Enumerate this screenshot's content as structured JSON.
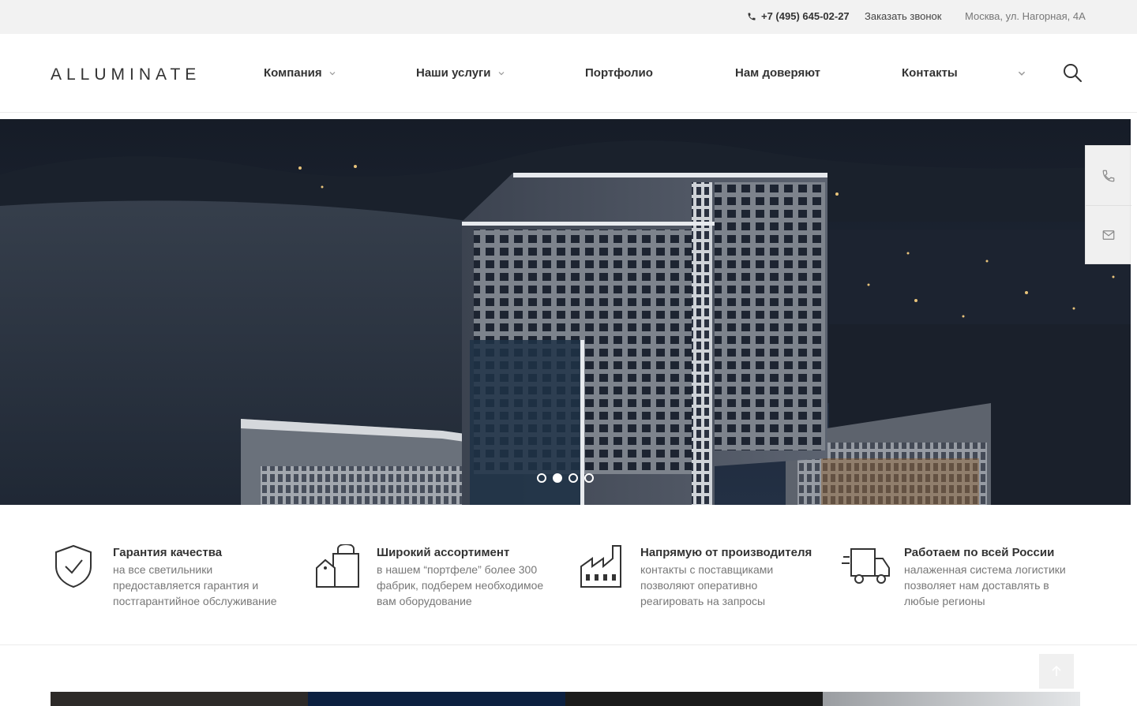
{
  "topbar": {
    "phone": "+7 (495) 645-02-27",
    "callback": "Заказать звонок",
    "address": "Москва, ул. Нагорная, 4А"
  },
  "header": {
    "logo": "ALLUMINATE",
    "nav": [
      {
        "label": "Компания"
      },
      {
        "label": "Наши услуги"
      },
      {
        "label": "Портфолио"
      },
      {
        "label": "Нам доверяют"
      },
      {
        "label": "Контакты"
      }
    ]
  },
  "hero": {
    "active_slide": 2,
    "slide_count": 4
  },
  "side_widget": {
    "icons": [
      "phone-icon",
      "mail-icon"
    ]
  },
  "features": [
    {
      "title": "Гарантия качества",
      "desc": "на все светильники предоставляется гарантия и постгарантийное обслуживание",
      "icon": "shield-check-icon"
    },
    {
      "title": "Широкий ассортимент",
      "desc": "в нашем “портфеле” более 300 фабрик, подберем необходимое вам оборудование",
      "icon": "shopping-bag-icon"
    },
    {
      "title": "Напрямую от производителя",
      "desc": "контакты с поставщиками позволяют оперативно реагировать на запросы",
      "icon": "factory-icon"
    },
    {
      "title": "Работаем по всей России",
      "desc": "налаженная система логистики позволяет нам доставлять в любые регионы",
      "icon": "truck-icon"
    }
  ],
  "colors": {
    "topbar_bg": "#f2f2f2",
    "text_dark": "#333333",
    "text_muted": "#777777",
    "hero_dark": "#1b2230"
  }
}
